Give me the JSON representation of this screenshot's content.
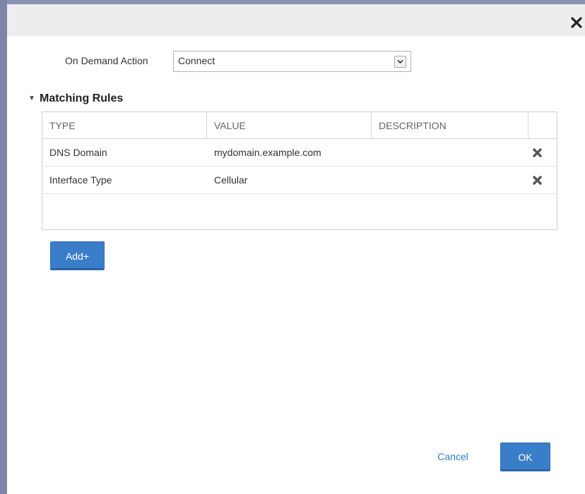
{
  "dialog": {
    "close_icon": "close-icon"
  },
  "on_demand": {
    "label": "On Demand Action",
    "selected": "Connect"
  },
  "matching_rules": {
    "title": "Matching Rules",
    "columns": [
      "TYPE",
      "VALUE",
      "DESCRIPTION"
    ],
    "rows": [
      {
        "type": "DNS Domain",
        "value": "mydomain.example.com",
        "description": ""
      },
      {
        "type": "Interface Type",
        "value": "Cellular",
        "description": ""
      }
    ],
    "add_label": "Add+"
  },
  "footer": {
    "cancel_label": "Cancel",
    "ok_label": "OK"
  },
  "colors": {
    "accent": "#3a7ec9",
    "link": "#2f7fcf",
    "header": "#ededed",
    "border": "#7d85a8"
  }
}
